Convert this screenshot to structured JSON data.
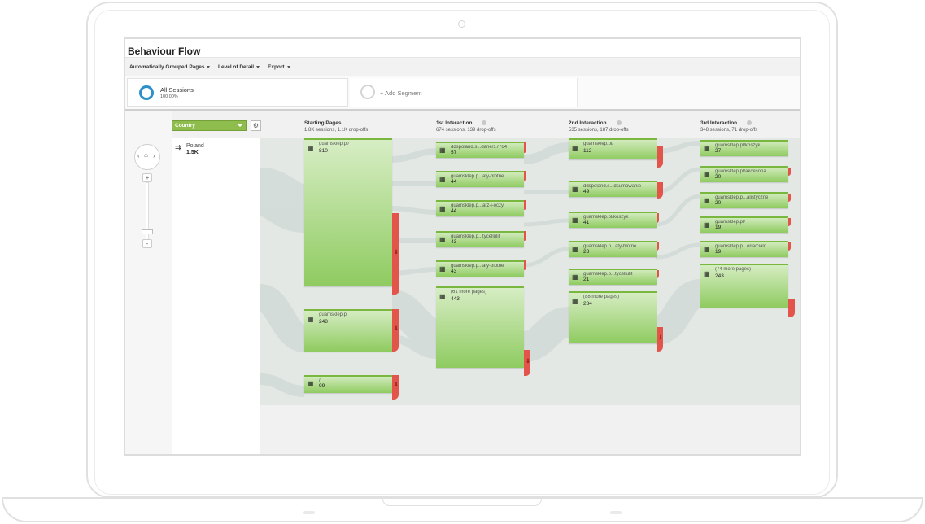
{
  "page": {
    "title": "Behaviour Flow"
  },
  "toolbar": {
    "grouped": "Automatically Grouped Pages",
    "detail": "Level of Detail",
    "export": "Export"
  },
  "segments": {
    "all_name": "All Sessions",
    "all_pct": "100.00%",
    "add": "+ Add Segment"
  },
  "dimension": {
    "selected": "Country",
    "country_name": "Poland",
    "country_value": "1.5K"
  },
  "columns": [
    {
      "title": "Starting Pages",
      "sub": "1.8K sessions, 1.1K drop-offs"
    },
    {
      "title": "1st Interaction",
      "sub": "674 sessions, 139 drop-offs"
    },
    {
      "title": "2nd Interaction",
      "sub": "535 sessions, 187 drop-offs"
    },
    {
      "title": "3rd Interaction",
      "sub": "348 sessions, 71 drop-offs"
    }
  ],
  "nodes": {
    "c0": [
      {
        "name": "guamsklep.pl/",
        "value": "810"
      },
      {
        "name": "guamsklep.pl",
        "value": "248"
      },
      {
        "name": "/",
        "value": "99"
      }
    ],
    "c1": [
      {
        "name": "ddspoland.s...dane/17764",
        "value": "57"
      },
      {
        "name": "guamsklep.p...aty-blotne",
        "value": "44"
      },
      {
        "name": "guamsklep.p...arz-i-oczy",
        "value": "44"
      },
      {
        "name": "guamsklep.p...tycellulit",
        "value": "43"
      },
      {
        "name": "guamsklep.p...aty-blotne",
        "value": "43"
      },
      {
        "name": "(61 more pages)",
        "value": "443"
      }
    ],
    "c2": [
      {
        "name": "guamsklep.pl/",
        "value": "112"
      },
      {
        "name": "ddspoland.s...dsumowanie",
        "value": "49"
      },
      {
        "name": "guamsklep.pl/koszyk",
        "value": "41"
      },
      {
        "name": "guamsklep.p...aty-blotne",
        "value": "28"
      },
      {
        "name": "guamsklep.p...tycellulit",
        "value": "21"
      },
      {
        "name": "(88 more pages)",
        "value": "284"
      }
    ],
    "c3": [
      {
        "name": "guamsklep.pl/koszyk",
        "value": "27"
      },
      {
        "name": "guamsklep.pl/akcesoria",
        "value": "20"
      },
      {
        "name": "guamsklep.p...alistyczne",
        "value": "20"
      },
      {
        "name": "guamsklep.pl/",
        "value": "19"
      },
      {
        "name": "guamsklep.p...oria/cialo",
        "value": "19"
      },
      {
        "name": "(74 more pages)",
        "value": "243"
      }
    ]
  },
  "colors": {
    "node_green": "#8fcb60",
    "dropoff_red": "#e3544a",
    "segment_blue": "#2b8fc9",
    "flow_gray": "#d3dcd8"
  },
  "icons": {
    "zoom_in": "+",
    "zoom_out": "-",
    "dropoff": "⇓",
    "page": "▦"
  }
}
